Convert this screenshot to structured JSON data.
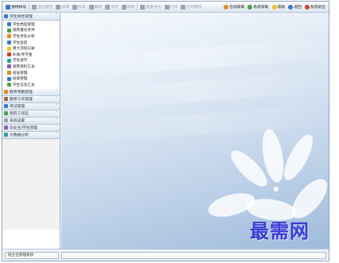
{
  "toolbar": {
    "left_items": [
      {
        "label": "独特帐号",
        "icon": "user-icon",
        "enabled": true,
        "color": "blue"
      },
      {
        "label": "显示报告",
        "icon": "report-icon",
        "enabled": false,
        "color": "gray"
      },
      {
        "label": "新增",
        "icon": "add-icon",
        "enabled": false,
        "color": "gray"
      },
      {
        "label": "修改",
        "icon": "edit-icon",
        "enabled": false,
        "color": "gray"
      },
      {
        "label": "删除",
        "icon": "delete-icon",
        "enabled": false,
        "color": "gray"
      },
      {
        "label": "保存",
        "icon": "save-icon",
        "enabled": false,
        "color": "gray"
      },
      {
        "label": "刷新",
        "icon": "refresh-icon",
        "enabled": false,
        "color": "gray"
      },
      {
        "label": "报表导出",
        "icon": "export-icon",
        "enabled": false,
        "color": "gray"
      },
      {
        "label": "打印",
        "icon": "print-icon",
        "enabled": false,
        "color": "gray"
      },
      {
        "label": "打印预览",
        "icon": "preview-icon",
        "enabled": false,
        "color": "gray"
      }
    ],
    "right_items": [
      {
        "label": "在线帮助",
        "icon": "help-icon",
        "color": "orange"
      },
      {
        "label": "系统帮助",
        "icon": "info-icon",
        "color": "green"
      },
      {
        "label": "帮助",
        "icon": "book-icon",
        "color": "yellow"
      },
      {
        "label": "返回",
        "icon": "back-icon",
        "color": "blue"
      },
      {
        "label": "系统退出",
        "icon": "exit-icon",
        "color": "red"
      }
    ]
  },
  "sidebar": {
    "panels": [
      {
        "label": "学生综合管理",
        "icon": "student-icon",
        "expanded": true,
        "items": [
          {
            "label": "学生档案管理",
            "icon": "folder-icon",
            "color": "blue"
          },
          {
            "label": "德育量化考评",
            "icon": "chart-icon",
            "color": "green"
          },
          {
            "label": "学生奖惩分析",
            "icon": "award-icon",
            "color": "orange"
          },
          {
            "label": "学生鉴定",
            "icon": "doc-icon",
            "color": "blue"
          },
          {
            "label": "重大违纪记录",
            "icon": "warning-icon",
            "color": "yellow"
          },
          {
            "label": "补助/奖学金",
            "icon": "money-icon",
            "color": "red"
          },
          {
            "label": "学生退学",
            "icon": "leave-icon",
            "color": "teal"
          },
          {
            "label": "德育资料汇总",
            "icon": "list-icon",
            "color": "purple"
          },
          {
            "label": "宿舍管理",
            "icon": "home-icon",
            "color": "orange"
          },
          {
            "label": "班级管理",
            "icon": "group-icon",
            "color": "blue"
          },
          {
            "label": "学生信息汇总",
            "icon": "table-icon",
            "color": "green"
          }
        ]
      },
      {
        "label": "教师考勤管理",
        "icon": "clock-icon",
        "expanded": false,
        "items": [],
        "color": "orange"
      },
      {
        "label": "教师工作管理",
        "icon": "briefcase-icon",
        "expanded": false,
        "items": [],
        "color": "brown"
      },
      {
        "label": "考试管理",
        "icon": "exam-icon",
        "expanded": false,
        "items": [],
        "color": "blue"
      },
      {
        "label": "我的工作区",
        "icon": "desk-icon",
        "expanded": false,
        "items": [],
        "color": "green"
      },
      {
        "label": "系统设置",
        "icon": "settings-icon",
        "expanded": false,
        "items": [],
        "color": "gray"
      },
      {
        "label": "毕业生/学生管理",
        "icon": "graduate-icon",
        "expanded": false,
        "items": [],
        "color": "purple"
      },
      {
        "label": "大数据分析",
        "icon": "analytics-icon",
        "expanded": false,
        "items": [],
        "color": "teal"
      }
    ]
  },
  "main": {
    "watermark": "最需网"
  },
  "statusbar": {
    "left_text": "班主任管理系统"
  },
  "colors": {
    "accent": "#3a79c6",
    "frame_border": "#8ea6c4",
    "desktop_top": "#f7fafd",
    "desktop_bottom": "#9fbadb",
    "watermark": "#3b3bd6"
  }
}
